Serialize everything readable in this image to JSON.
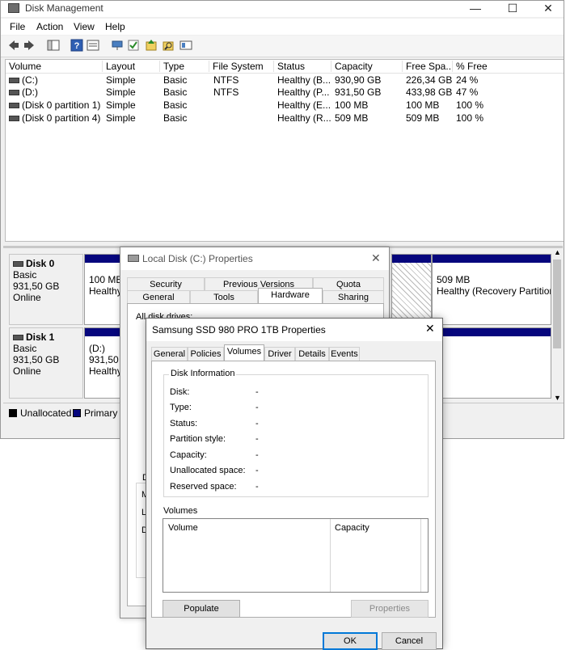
{
  "window": {
    "title": "Disk Management",
    "minimize_glyph": "—",
    "maximize_glyph": "☐",
    "close_glyph": "✕"
  },
  "menu": [
    "File",
    "Action",
    "View",
    "Help"
  ],
  "toolbar": {
    "icons": [
      "back-icon",
      "forward-icon",
      "show-hide-console-tree-icon",
      "help-icon",
      "properties-icon",
      "connect-icon",
      "check-icon",
      "up-icon",
      "search-icon",
      "view-icon"
    ]
  },
  "volume_list": {
    "columns": [
      "Volume",
      "Layout",
      "Type",
      "File System",
      "Status",
      "Capacity",
      "Free Spa...",
      "% Free"
    ],
    "rows": [
      {
        "volume": "(C:)",
        "layout": "Simple",
        "type": "Basic",
        "fs": "NTFS",
        "status": "Healthy (B...",
        "capacity": "930,90 GB",
        "free": "226,34 GB",
        "pct": "24 %"
      },
      {
        "volume": "(D:)",
        "layout": "Simple",
        "type": "Basic",
        "fs": "NTFS",
        "status": "Healthy (P...",
        "capacity": "931,50 GB",
        "free": "433,98 GB",
        "pct": "47 %"
      },
      {
        "volume": "(Disk 0 partition 1)",
        "layout": "Simple",
        "type": "Basic",
        "fs": "",
        "status": "Healthy (E...",
        "capacity": "100 MB",
        "free": "100 MB",
        "pct": "100 %"
      },
      {
        "volume": "(Disk 0 partition 4)",
        "layout": "Simple",
        "type": "Basic",
        "fs": "",
        "status": "Healthy (R...",
        "capacity": "509 MB",
        "free": "509 MB",
        "pct": "100 %"
      }
    ]
  },
  "disks": [
    {
      "name": "Disk 0",
      "type": "Basic",
      "size": "931,50 GB",
      "state": "Online",
      "p1_size": "100 MB",
      "p1_status": "Healthy",
      "p_last_size": "509 MB",
      "p_last_status": "Healthy (Recovery Partition"
    },
    {
      "name": "Disk 1",
      "type": "Basic",
      "size": "931,50 GB",
      "state": "Online",
      "p1_name": "(D:)",
      "p1_size": "931,50 G",
      "p1_status": "Healthy"
    }
  ],
  "legend": {
    "unallocated": "Unallocated",
    "primary": "Primary p",
    "unallocated_color": "#000000",
    "primary_color": "#06067d"
  },
  "local_disk_dialog": {
    "title": "Local Disk (C:) Properties",
    "close_glyph": "✕",
    "tabs_row1": [
      "Security",
      "Previous Versions",
      "Quota"
    ],
    "tabs_row2": [
      "General",
      "Tools",
      "Hardware",
      "Sharing"
    ],
    "active_tab": "Hardware",
    "body_partial": "All disk drives:",
    "partial_letters": [
      "D",
      "M",
      "L",
      "D"
    ]
  },
  "samsung_dialog": {
    "title": "Samsung SSD 980 PRO 1TB Properties",
    "close_glyph": "✕",
    "tabs": [
      "General",
      "Policies",
      "Volumes",
      "Driver",
      "Details",
      "Events"
    ],
    "active_tab": "Volumes",
    "disk_info_title": "Disk Information",
    "info": [
      {
        "label": "Disk:",
        "value": "-"
      },
      {
        "label": "Type:",
        "value": "-"
      },
      {
        "label": "Status:",
        "value": "-"
      },
      {
        "label": "Partition style:",
        "value": "-"
      },
      {
        "label": "Capacity:",
        "value": "-"
      },
      {
        "label": "Unallocated space:",
        "value": "-"
      },
      {
        "label": "Reserved space:",
        "value": "-"
      }
    ],
    "volumes_title": "Volumes",
    "volumes_columns": [
      "Volume",
      "Capacity"
    ],
    "populate_label": "Populate",
    "properties_label": "Properties",
    "ok_label": "OK",
    "cancel_label": "Cancel"
  }
}
